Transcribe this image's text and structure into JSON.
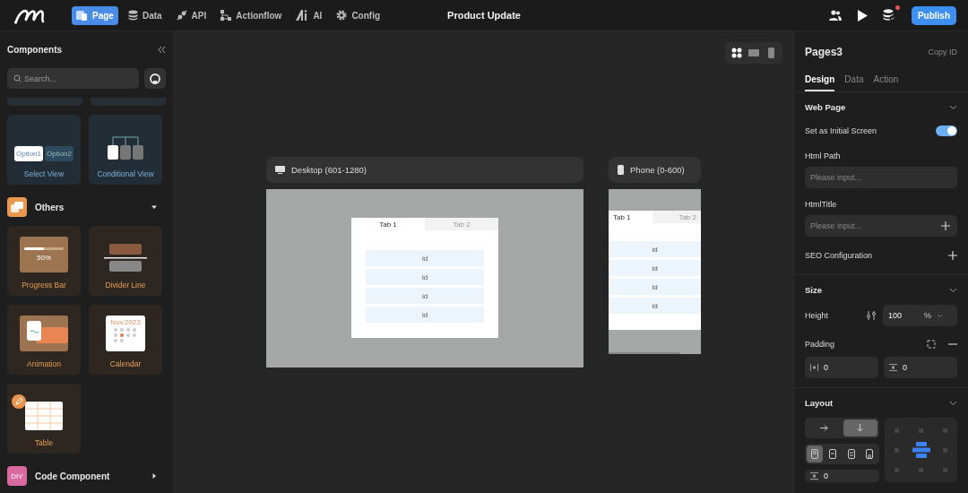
{
  "topbar": {
    "nav": [
      {
        "label": "Page",
        "selected": true
      },
      {
        "label": "Data",
        "selected": false
      },
      {
        "label": "API",
        "selected": false
      },
      {
        "label": "Actionflow",
        "selected": false
      },
      {
        "label": "AI",
        "selected": false
      },
      {
        "label": "Config",
        "selected": false
      }
    ],
    "title": "Product Update",
    "notification": true,
    "publish": "Publish"
  },
  "sidebar": {
    "title": "Components",
    "search": {
      "placeholder": "Search..."
    },
    "cards": [
      {
        "label": "Select View",
        "kind": "select",
        "options": [
          "Option1",
          "Option2"
        ]
      },
      {
        "label": "Conditional View",
        "kind": "conditional"
      }
    ],
    "sections": [
      {
        "title": "Others",
        "kind": "others",
        "expanded": true,
        "cards": [
          {
            "label": "Progress Bar",
            "kind": "progress",
            "reading": "50%",
            "level": 0.5
          },
          {
            "label": "Divider Line",
            "kind": "divider"
          },
          {
            "label": "Animation",
            "kind": "animation"
          },
          {
            "label": "Calendar",
            "kind": "calendar",
            "heading": "Nov.2023"
          },
          {
            "label": "Table",
            "kind": "table"
          }
        ]
      },
      {
        "title": "Code Component",
        "kind": "code",
        "icon_text": "DIY",
        "expanded": false
      }
    ]
  },
  "canvas": {
    "view_modes": [
      {
        "selected": true
      },
      {
        "selected": false
      },
      {
        "selected": false
      }
    ],
    "previews": [
      {
        "kind": "desktop",
        "label": "Desktop (601-1280)",
        "tabs": [
          {
            "label": "Tab 1",
            "selected": true
          },
          {
            "label": "Tab 2",
            "selected": false
          }
        ],
        "items": [
          "id",
          "id",
          "id",
          "id"
        ]
      },
      {
        "kind": "phone",
        "label": "Phone (0-600)",
        "tabs": [
          {
            "label": "Tab 1",
            "selected": true
          },
          {
            "label": "Tab 2",
            "selected": false
          }
        ],
        "items": [
          "id",
          "id",
          "id",
          "id"
        ]
      }
    ]
  },
  "inspector": {
    "title": "Pages3",
    "copy": "Copy ID",
    "tabs": [
      {
        "label": "Design",
        "selected": true
      },
      {
        "label": "Data",
        "selected": false
      },
      {
        "label": "Action",
        "selected": false
      }
    ],
    "web_page": {
      "title": "Web Page",
      "initial_screen": {
        "label": "Set as Initial Screen",
        "on": true
      },
      "html_path": {
        "label": "Html Path",
        "placeholder": "Please input..."
      },
      "html_title": {
        "label": "HtmlTitle",
        "placeholder": "Please input..."
      },
      "seo": {
        "label": "SEO Configuration"
      }
    },
    "size": {
      "title": "Size",
      "height": {
        "label": "Height",
        "value": "100",
        "unit": "%"
      },
      "padding": {
        "label": "Padding",
        "horizontal": "0",
        "vertical": "0"
      }
    },
    "layout": {
      "title": "Layout",
      "direction": [
        {
          "selected": false
        },
        {
          "selected": true
        }
      ],
      "alignment": [
        {
          "selected": true
        },
        {
          "selected": false
        },
        {
          "selected": false
        },
        {
          "selected": false
        }
      ],
      "grid": [
        {
          "selected": false
        },
        {
          "selected": false
        },
        {
          "selected": false
        },
        {
          "selected": false
        },
        {
          "selected": true
        },
        {
          "selected": false
        },
        {
          "selected": false
        },
        {
          "selected": false
        },
        {
          "selected": false
        }
      ],
      "gap": "0"
    }
  }
}
